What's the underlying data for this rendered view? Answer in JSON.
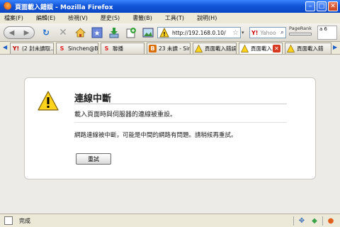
{
  "window": {
    "title": "頁面載入錯誤 - Mozilla Firefox"
  },
  "menu": [
    "檔案(F)",
    "編輯(E)",
    "檢視(V)",
    "歷史(S)",
    "書籤(B)",
    "工具(T)",
    "說明(H)"
  ],
  "toolbar": {
    "url": "http://192.168.0.10/",
    "search_placeholder": "Yahoo",
    "search_engine_icon": "Y!",
    "pagerank_label": "PageRank",
    "extra_text": "a 6"
  },
  "tabs": [
    {
      "label": "(2 封未讀取...",
      "icon": "Y!",
      "icon_color": "#c00000"
    },
    {
      "label": "Sinchen@Bl...",
      "icon": "S",
      "icon_color": "#e02020"
    },
    {
      "label": "聯播",
      "icon": "S",
      "icon_color": "#e02020"
    },
    {
      "label": "23 未讀 - Sin...",
      "icon": "B",
      "icon_color": "#d96d00"
    },
    {
      "label": "頁面載入錯誤",
      "icon": "!",
      "icon_color": "#b08800"
    },
    {
      "label": "頁面載入...",
      "icon": "!",
      "icon_color": "#b08800",
      "active": true
    },
    {
      "label": "頁面載入錯",
      "icon": "!",
      "icon_color": "#b08800"
    }
  ],
  "error": {
    "title": "連線中斷",
    "short_desc": "載入頁面時與伺服器的連線被重設。",
    "long_desc": "網路連線被中斷，可能是中間的網路有問題。請稍候再重試。",
    "retry_label": "重試"
  },
  "status": {
    "text": "完成"
  }
}
